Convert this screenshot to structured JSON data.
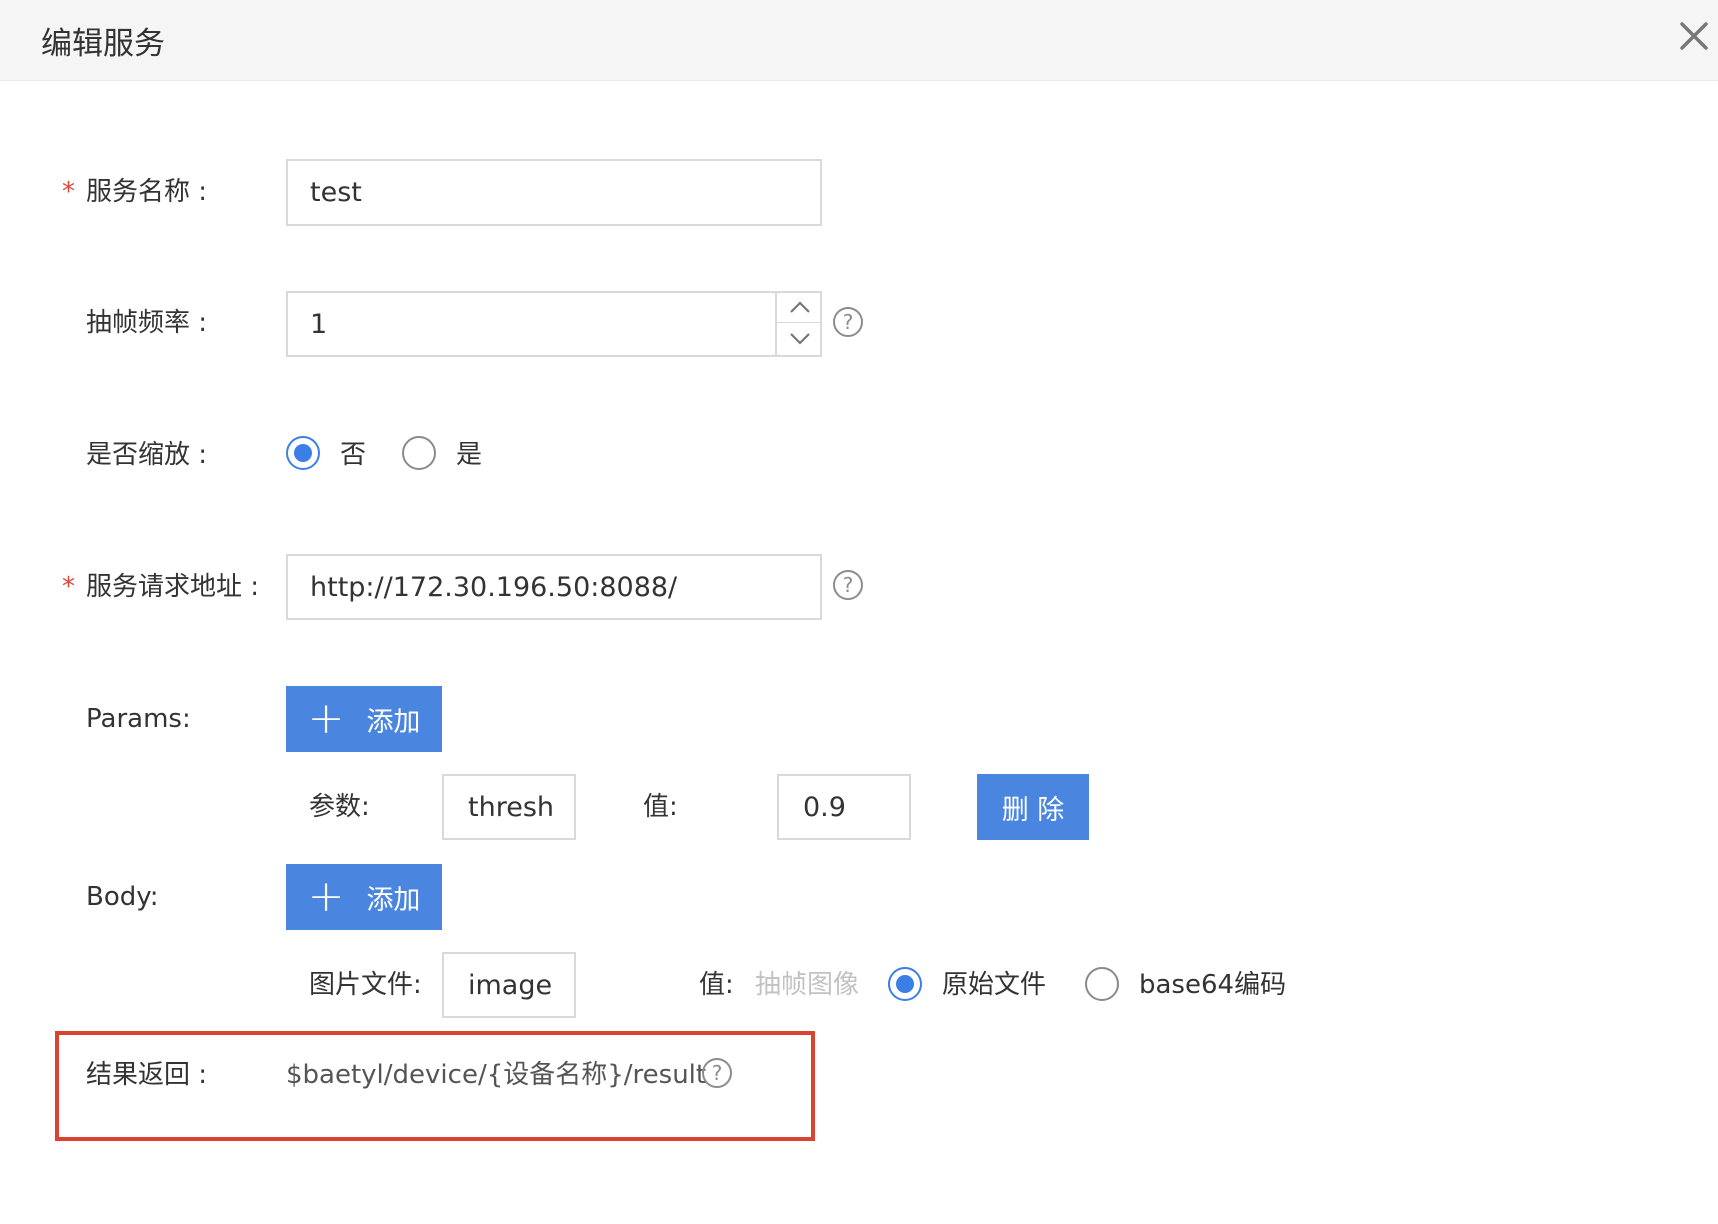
{
  "dialog": {
    "title": "编辑服务",
    "close_icon": "close-icon"
  },
  "form": {
    "service_name": {
      "required_mark": "*",
      "label": "服务名称 :",
      "value": "test"
    },
    "frame_rate": {
      "label": "抽帧频率 :",
      "value": "1",
      "help": "?"
    },
    "scaling": {
      "label": "是否缩放 :",
      "options": [
        {
          "label": "否",
          "checked": true
        },
        {
          "label": "是",
          "checked": false
        }
      ]
    },
    "request_url": {
      "required_mark": "*",
      "label": "服务请求地址 :",
      "value": "http://172.30.196.50:8088/",
      "help": "?"
    },
    "params": {
      "label": "Params:",
      "add_label": "添加",
      "param_label": "参数:",
      "param_value": "thresh",
      "value_label": "值:",
      "value_value": "0.9",
      "delete_label": "删 除"
    },
    "body": {
      "label": "Body:",
      "add_label": "添加",
      "file_label": "图片文件:",
      "file_value": "image",
      "value_label": "值:",
      "options": [
        {
          "label": "抽帧图像",
          "disabled": true
        },
        {
          "label": "原始文件",
          "checked": true
        },
        {
          "label": "base64编码",
          "checked": false
        }
      ]
    },
    "result": {
      "label": "结果返回 :",
      "value": "$baetyl/device/{设备名称}/result",
      "help": "?"
    }
  },
  "colors": {
    "primary": "#4a86e0",
    "required": "#e0453a",
    "highlight": "#d9432f"
  }
}
